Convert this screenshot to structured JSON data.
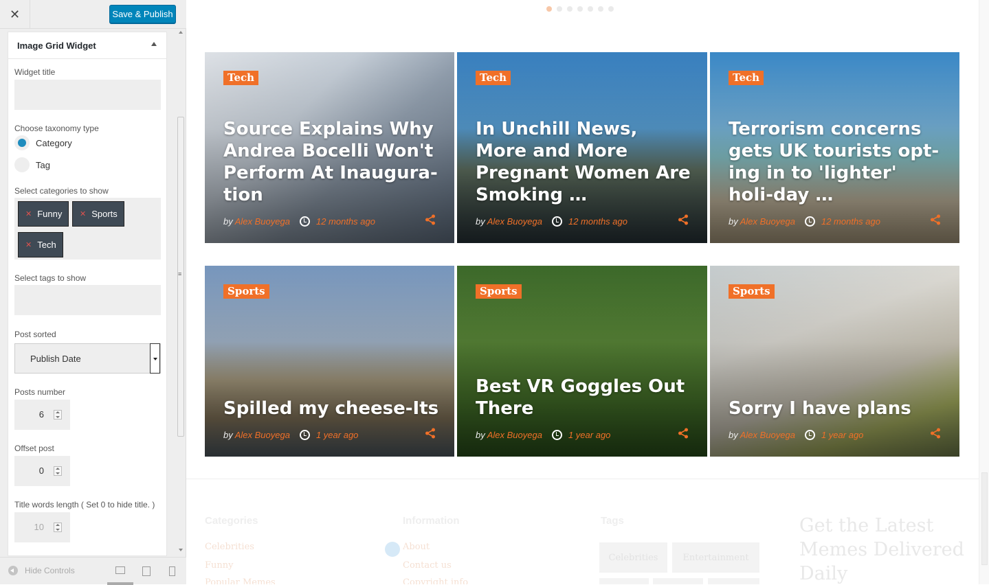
{
  "topbar": {
    "close_label": "✕",
    "save_label": "Save & Publish"
  },
  "widget": {
    "title": "Image Grid Widget",
    "fields": {
      "widget_title_label": "Widget title",
      "taxonomy_label": "Choose taxonomy type",
      "taxonomy_options": [
        "Category",
        "Tag"
      ],
      "taxonomy_selected": "Category",
      "categories_label": "Select categories to show",
      "categories": [
        "Funny",
        "Sports",
        "Tech"
      ],
      "tags_label": "Select tags to show",
      "sorted_label": "Post sorted",
      "sorted_value": "Publish Date",
      "posts_number_label": "Posts number",
      "posts_number": "6",
      "offset_label": "Offset post",
      "offset": "0",
      "title_words_label": "Title words length ( Set 0 to hide title. )",
      "title_words": "10"
    }
  },
  "footer_controls": {
    "hide_label": "Hide Controls"
  },
  "slider_dots": 7,
  "posts": [
    {
      "category": "Tech",
      "title": "Source Explains Why Andrea Bocelli Won't Perform At Inaugura-tion",
      "by": "by",
      "author": "Alex Buoyega",
      "time": "12 months ago"
    },
    {
      "category": "Tech",
      "title": "In Unchill News, More and More Pregnant Women Are Smoking …",
      "by": "by",
      "author": "Alex Buoyega",
      "time": "12 months ago"
    },
    {
      "category": "Tech",
      "title": "Terrorism concerns gets UK tourists opt-ing in to 'lighter' holi-day …",
      "by": "by",
      "author": "Alex Buoyega",
      "time": "12 months ago"
    },
    {
      "category": "Sports",
      "title": "Spilled my cheese-Its",
      "by": "by",
      "author": "Alex Buoyega",
      "time": "1 year ago"
    },
    {
      "category": "Sports",
      "title": "Best VR Goggles Out There",
      "by": "by",
      "author": "Alex Buoyega",
      "time": "1 year ago"
    },
    {
      "category": "Sports",
      "title": "Sorry I have plans",
      "by": "by",
      "author": "Alex Buoyega",
      "time": "1 year ago"
    }
  ],
  "site_footer": {
    "categories_head": "Categories",
    "categories_links": [
      "Celebrities",
      "Funny",
      "Popular Memes"
    ],
    "information_head": "Information",
    "information_links": [
      "About",
      "Contact us",
      "Copyright info"
    ],
    "tags_head": "Tags",
    "tags": [
      "Celebrities",
      "Entertainment"
    ],
    "newsletter": "Get the Latest Memes Delivered Daily"
  },
  "colors": {
    "accent": "#f07028",
    "button": "#0085ba",
    "chip": "#3f4a55"
  }
}
